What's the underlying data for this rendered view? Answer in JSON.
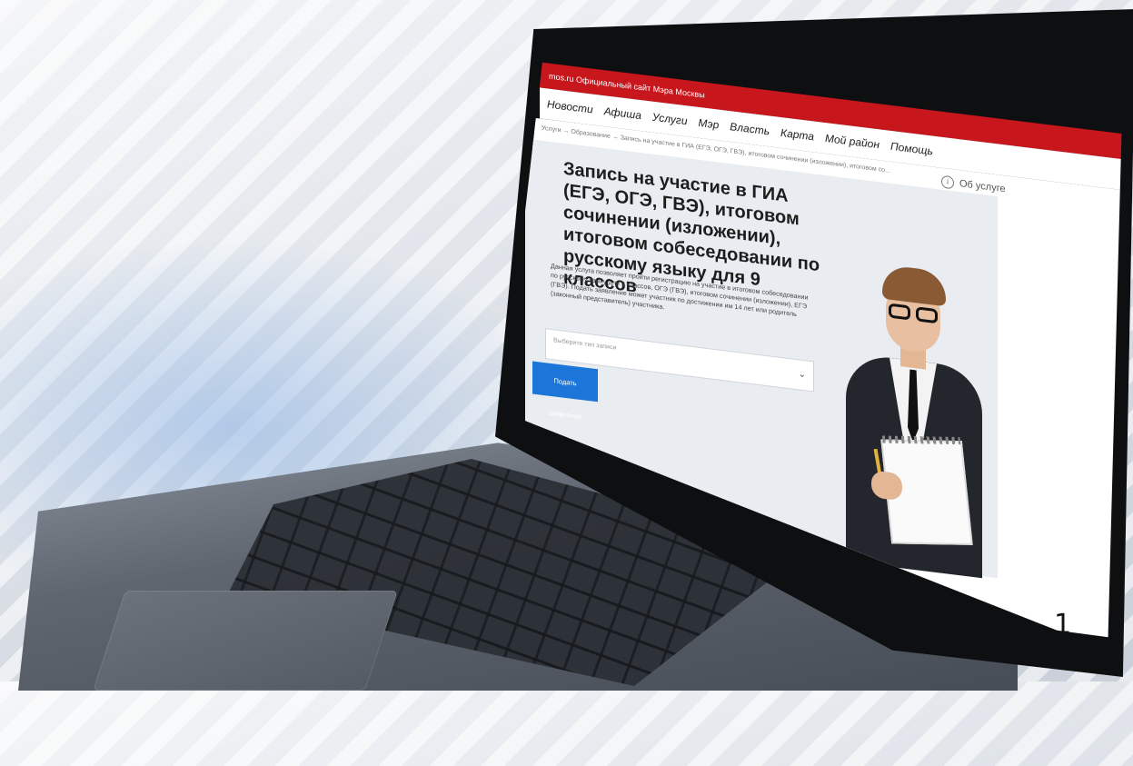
{
  "browser": {
    "topbar_text": "mos.ru   Официальный сайт Мэра Москвы"
  },
  "nav": {
    "items": [
      "Новости",
      "Афиша",
      "Услуги",
      "Мэр",
      "Власть",
      "Карта",
      "Мой район",
      "Помощь"
    ]
  },
  "breadcrumbs": "Услуги → Образование → Запись на участие в ГИА (ЕГЭ, ОГЭ, ГВЭ), итоговом сочинении (изложении), итоговом со...",
  "about_link": "Об услуге",
  "service": {
    "title": "Запись на участие в ГИА (ЕГЭ, ОГЭ, ГВЭ), итоговом сочинении (изложении), итоговом собеседовании по русскому языку для 9 классов",
    "description": "Данная услуга позволяет пройти регистрацию на участие в итоговом собеседовании по русскому языку для 9 классов, ОГЭ (ГВЭ), итоговом сочинении (изложении), ЕГЭ (ГВЭ). Подать заявление может участник по достижении им 14 лет или родитель (законный представитель) участника.",
    "select_placeholder": "Выберите тип записи",
    "submit_label": "Подать заявление"
  },
  "slide_number": "1"
}
